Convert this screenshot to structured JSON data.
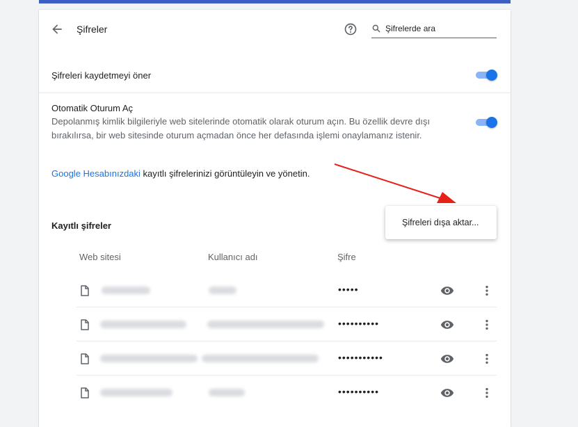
{
  "header": {
    "title": "Şifreler",
    "search_placeholder": "Şifrelerde ara"
  },
  "settings": {
    "offer_save": {
      "label": "Şifreleri kaydetmeyi öner",
      "enabled": true
    },
    "auto_signin": {
      "label": "Otomatik Oturum Aç",
      "description_line1": "Depolanmış kimlik bilgileriyle web sitelerinde otomatik olarak oturum açın. Bu özellik devre dışı",
      "description_line2": "bırakılırsa, bir web sitesinde oturum açmadan önce her defasında işlemi onaylamanız istenir.",
      "enabled": true
    }
  },
  "google_account": {
    "link_text": "Google Hesabınızdaki",
    "rest_text": " kayıtlı şifrelerinizi görüntüleyin ve yönetin."
  },
  "saved_passwords": {
    "section_title": "Kayıtlı şifreler",
    "columns": {
      "site": "Web sitesi",
      "username": "Kullanıcı adı",
      "password": "Şifre"
    },
    "rows": [
      {
        "password_mask": "•••••"
      },
      {
        "password_mask": "••••••••••"
      },
      {
        "password_mask": "•••••••••••"
      },
      {
        "password_mask": "••••••••••"
      }
    ]
  },
  "popup_menu": {
    "export_label": "Şifreleri dışa aktar..."
  },
  "icons": [
    "back-arrow-icon",
    "help-icon",
    "search-icon",
    "file-icon",
    "eye-icon",
    "more-vert-icon"
  ],
  "colors": {
    "accent": "#1a73e8",
    "toggle_track": "#8ab4f8",
    "annotation_arrow": "#e8201a"
  }
}
